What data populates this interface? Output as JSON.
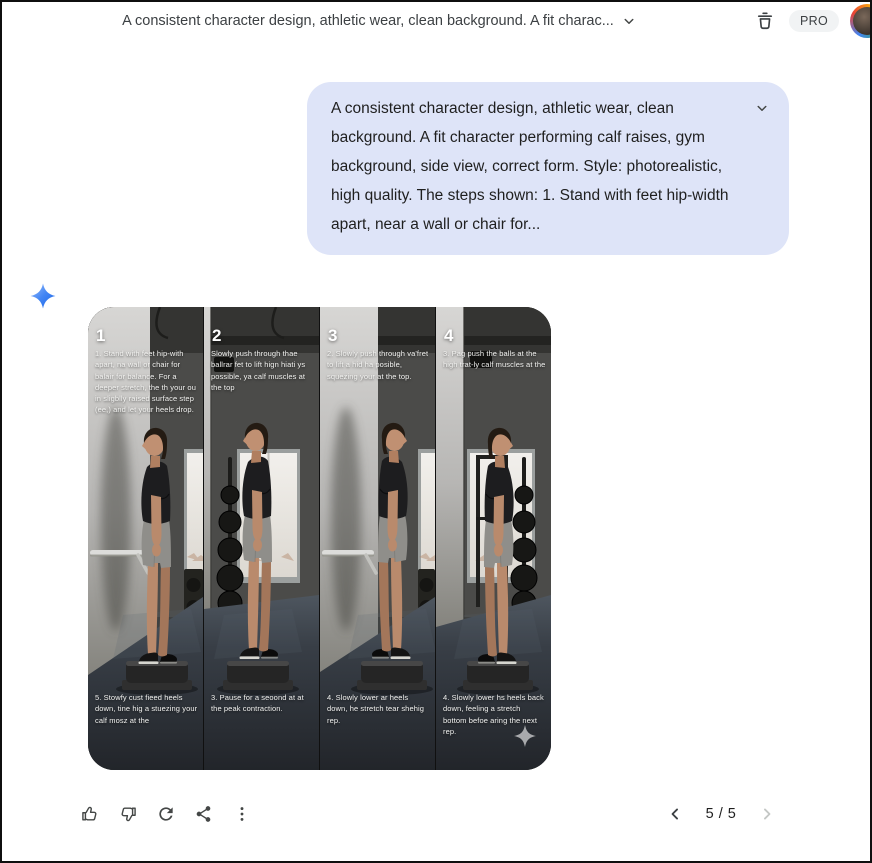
{
  "header": {
    "title": "A consistent character design, athletic wear, clean background.  A fit charac...",
    "pro_badge": "PRO",
    "icons": [
      "chevron-down-icon",
      "delete-icon",
      "account-avatar"
    ]
  },
  "user_message": {
    "text": "A consistent character design, athletic wear, clean background.  A fit character performing calf raises, gym background, side view, correct form. Style: photorealistic, high quality.  The steps shown: 1. Stand with feet hip-width apart, near a wall or chair for...",
    "collapse_icon": "chevron-down-icon"
  },
  "response": {
    "avatar_icon": "gemini-sparkle-icon"
  },
  "generated_image": {
    "alt": "Four-panel photorealistic image of a fit man in a black t-shirt and grey shorts performing calf raises on a black step platform in a gym, side view",
    "watermark_icon": "gemini-sparkle-watermark",
    "panels": [
      {
        "number": "1",
        "top_caption": "1. Stand with feet hip-with apart, na wall or chair for balair for balance. For a deeper stretch, the th your ou in sligblly raised surface step (ee,) and let your heels drop.",
        "bottom_caption": "5. Stowfy cust fieed heels down, tine hig a stuezing your calf mosz at the"
      },
      {
        "number": "2",
        "top_caption": "Slowly push through thae ballrar fet to lift hign hiati ys possible, ya calf muscles at the top",
        "bottom_caption": "3. Pause for a seoond at at the peak contraction."
      },
      {
        "number": "3",
        "top_caption": "2. Slowly push through va'fret to lift a hid ha posible, squezing your at the top.",
        "bottom_caption": "4. Slowly lower ar heels down, he stretch tear shehig rep."
      },
      {
        "number": "4",
        "top_caption": "3.  Pag push the balls at the high trat-ly calf muscles at the",
        "bottom_caption": "4. Slowly lower hs heels back down, feeling a stretch bottom befoe aring the next rep."
      }
    ]
  },
  "toolbar": {
    "buttons": [
      {
        "name": "thumb-up"
      },
      {
        "name": "thumb-down"
      },
      {
        "name": "regenerate"
      },
      {
        "name": "share"
      },
      {
        "name": "more-options"
      }
    ]
  },
  "pagination": {
    "label": "5 / 5",
    "current": "5",
    "total": "5"
  },
  "colors": {
    "user_bubble": "#dee4f8",
    "icon_gray": "#444746",
    "sparkle_light": "#9cc0fb",
    "sparkle_dark": "#1b66e8",
    "disabled_gray": "#c4c7c5"
  }
}
